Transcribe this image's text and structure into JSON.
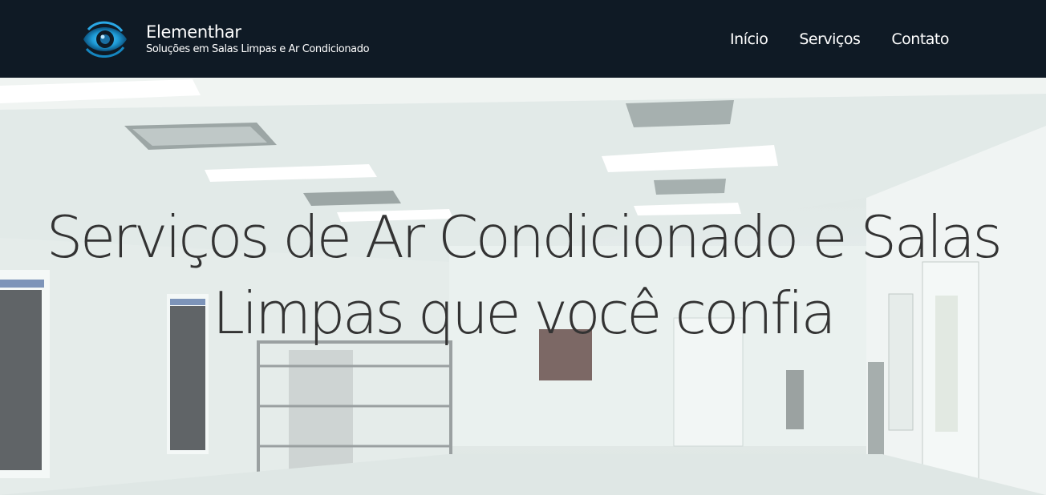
{
  "header": {
    "brand_name": "Elementhar",
    "brand_tagline": "Soluções em Salas Limpas e Ar Condicionado",
    "logo_icon": "eye-swirl-logo",
    "nav": [
      {
        "label": "Início"
      },
      {
        "label": "Serviços"
      },
      {
        "label": "Contato"
      }
    ]
  },
  "hero": {
    "title_line1": "Serviços de Ar Condicionado e Salas",
    "title_line2": "Limpas que você confia",
    "background_image": "cleanroom-photo"
  },
  "colors": {
    "navbar_bg": "#0f1a25",
    "nav_text": "#ffffff",
    "hero_text": "#333333",
    "logo_accent": "#1e9bd7"
  }
}
